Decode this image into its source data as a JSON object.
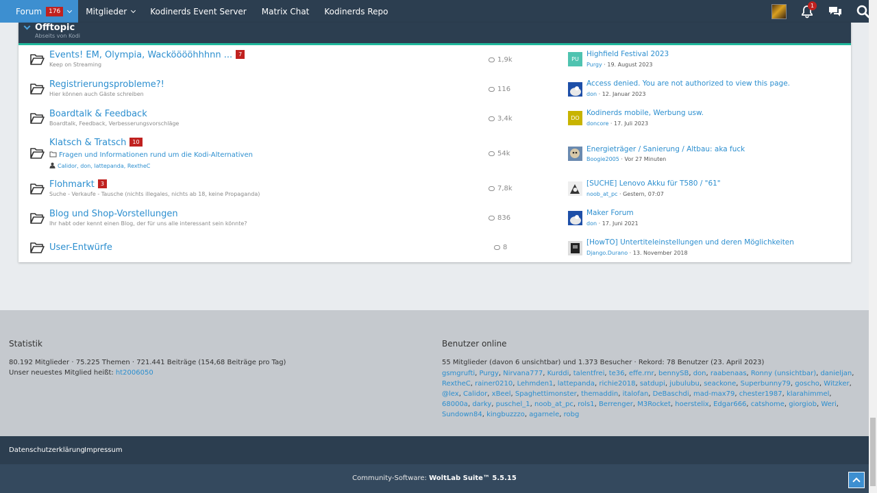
{
  "nav": {
    "items": [
      {
        "label": "Forum",
        "badge": "176"
      },
      {
        "label": "Mitglieder"
      },
      {
        "label": "Kodinerds Event Server"
      },
      {
        "label": "Matrix Chat"
      },
      {
        "label": "Kodinerds Repo"
      }
    ],
    "notification_count": "1",
    "accent": "#3d8fd0"
  },
  "category": {
    "title": "Offtopic",
    "description": "Abseits von Kodi"
  },
  "boards": [
    {
      "title": "Events! EM, Olympia, Wackööööhhhnn ...",
      "badge": "7",
      "description": "Keep on Streaming",
      "count": "1,9k",
      "last_title": "Highfield Festival 2023",
      "last_user": "Purgy",
      "last_date": "19. August 2023",
      "avatar_text": "PU",
      "avatar_color": "#4fc3b0"
    },
    {
      "title": "Registrierungsprobleme?!",
      "description": "Hier können auch Gäste schreiben",
      "count": "116",
      "last_title": "Access denied. You are not authorized to view this page.",
      "last_user": "don",
      "last_date": "12. Januar 2023",
      "avatar_color": "#1e4fa8"
    },
    {
      "title": "Boardtalk & Feedback",
      "description": "Boardtalk, Feedback, Verbesserungsvorschläge",
      "count": "3,4k",
      "last_title": "Kodinerds mobile, Werbung usw.",
      "last_user": "doncore",
      "last_date": "17. Juli 2023",
      "avatar_text": "DO",
      "avatar_color": "#c8b400"
    },
    {
      "title": "Klatsch & Tratsch",
      "badge": "10",
      "subforum": "Fragen und Informationen rund um die Kodi-Alternativen",
      "moderators": [
        "Calidor",
        "don",
        "lattepanda",
        "RextheC"
      ],
      "count": "54k",
      "last_title": "Energieträger / Sanierung / Altbau: aka fuck",
      "last_user": "Boogie2005",
      "last_date": "Vor 27 Minuten",
      "avatar_color": "#8a7a6a"
    },
    {
      "title": "Flohmarkt",
      "badge": "3",
      "description": "Suche - Verkaufe - Tausche (nichts illegales, nichts ab 18, keine Propaganda)",
      "count": "7,8k",
      "last_title": "[SUCHE] Lenovo Akku für T580 / \"61\"",
      "last_user": "noob_at_pc",
      "last_date": "Gestern, 07:07",
      "avatar_color": "#555555"
    },
    {
      "title": "Blog und Shop-Vorstellungen",
      "description": "Ihr habt oder kennt einen Blog, der für uns alle interessant sein könnte?",
      "count": "836",
      "last_title": "Maker Forum",
      "last_user": "don",
      "last_date": "17. Juni 2021",
      "avatar_color": "#1e4fa8"
    },
    {
      "title": "User-Entwürfe",
      "count": "8",
      "last_title": "[HowTO] Untertiteleinstellungen und deren Möglichkeiten",
      "last_user": "Django.Durano",
      "last_date": "13. November 2018",
      "avatar_color": "#333333"
    }
  ],
  "stats": {
    "heading": "Statistik",
    "line1": "80.192 Mitglieder · 75.225 Themen · 721.441 Beiträge (154,68 Beiträge pro Tag)",
    "line2_prefix": "Unser neuestes Mitglied heißt:",
    "newest_member": "ht2006050"
  },
  "online": {
    "heading": "Benutzer online",
    "summary": "55 Mitglieder (davon 6 unsichtbar) und 1.373 Besucher · Rekord: 78 Benutzer (23. April 2023)",
    "users": [
      "gsmgrufti",
      "Purgy",
      "Nirvana777",
      "Kurddi",
      "talentfrei",
      "te36",
      "effe.rnr",
      "bennySB",
      "don",
      "raabenaas",
      "Ronny (unsichtbar)",
      "danieljan",
      "RextheC",
      "rainer0210",
      "Lehmden1",
      "lattepanda",
      "richie2018",
      "satdupi",
      "jubulubu",
      "seackone",
      "Superbunny79",
      "goscho",
      "Witzker",
      "@lex",
      "Calidor",
      "xBeel",
      "Spaghettimonster",
      "themaddin",
      "italofan",
      "DeBaschdi",
      "mad-max79",
      "chester1987",
      "klarahimmel",
      "68000a",
      "darky",
      "puschel_1",
      "noob_at_pc",
      "rols1",
      "Berrenger",
      "M3Rocket",
      "hoerstelix",
      "Edgar666",
      "catshome",
      "giorgiob",
      "Weri",
      "Sundown84",
      "kingbuzzzo",
      "agarnele",
      "robg"
    ]
  },
  "footer": {
    "privacy": "Datenschutzerklärung",
    "imprint": "Impressum",
    "copyright_prefix": "Community-Software:",
    "software": "WoltLab Suite™ 5.5.15"
  }
}
